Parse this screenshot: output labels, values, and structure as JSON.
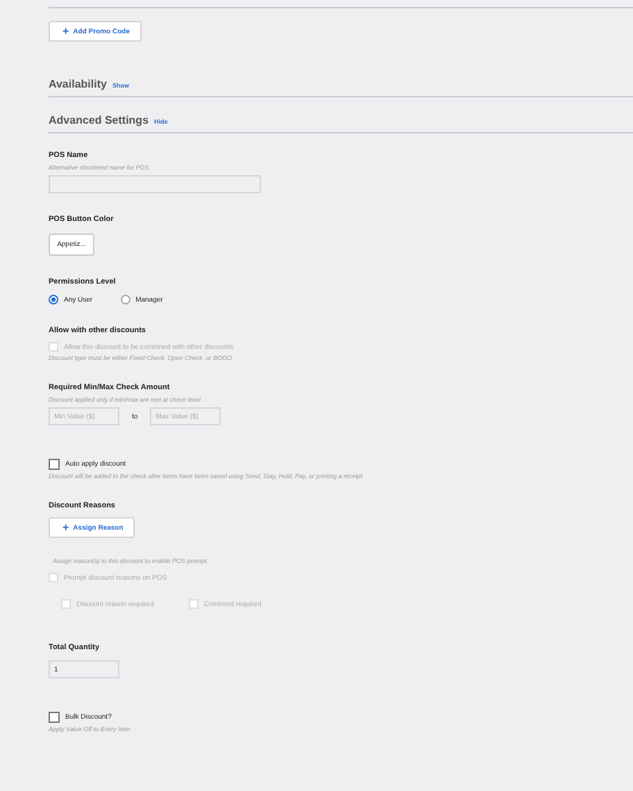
{
  "promo_codes": {
    "add_button": {
      "icon": "+",
      "label": "Add Promo Code"
    }
  },
  "sections": [
    {
      "title": "Availability",
      "toggle": "Show"
    },
    {
      "title": "Advanced Settings",
      "toggle": "Hide"
    }
  ],
  "fields": [
    {
      "kind": "text",
      "label": "POS Name",
      "hint": "Alternative shortened name for POS"
    },
    {
      "kind": "color",
      "label": "POS Button Color",
      "value": "Appetiz..."
    },
    {
      "kind": "radios",
      "label": "Permissions Level",
      "options": [
        {
          "label": "Any User",
          "selected": true
        },
        {
          "label": "Manager",
          "selected": false
        }
      ]
    },
    {
      "kind": "checkgroup",
      "label": "Allow with other discounts",
      "check": {
        "label": "Allow this discount to be combined with other discounts",
        "checked": false,
        "disabled": true
      },
      "note": "Discount type must be either Fixed Check, Open Check, or BOGO."
    },
    {
      "kind": "range",
      "label": "Required Min/Max Check Amount",
      "hint": "Discount applied only if min/max are met at check level",
      "min_placeholder": "Min Value ($)",
      "separator": "to",
      "max_placeholder": "Max Value ($)"
    },
    {
      "kind": "check",
      "check": {
        "label": "Auto apply discount",
        "checked": false,
        "disabled": false
      },
      "note": "Discount will be added to the check after items have been saved using Send, Stay, Hold, Pay, or printing a receipt"
    },
    {
      "kind": "reasons",
      "label": "Discount Reasons",
      "button": {
        "icon": "+",
        "label": "Assign Reason"
      },
      "hint": "Assign reason(s) to this discount to enable POS prompt.",
      "check": {
        "label": "Prompt discount reasons on POS",
        "checked": false,
        "disabled": true
      },
      "sub_checks": [
        {
          "label": "Discount reason required",
          "checked": false,
          "disabled": true
        },
        {
          "label": "Comment required",
          "checked": false,
          "disabled": true
        }
      ]
    },
    {
      "kind": "number",
      "label": "Total Quantity",
      "value": "1"
    },
    {
      "kind": "check",
      "check": {
        "label": "Bulk Discount?",
        "checked": false,
        "disabled": false
      },
      "note": "Apply Value Off to Every Item"
    }
  ]
}
